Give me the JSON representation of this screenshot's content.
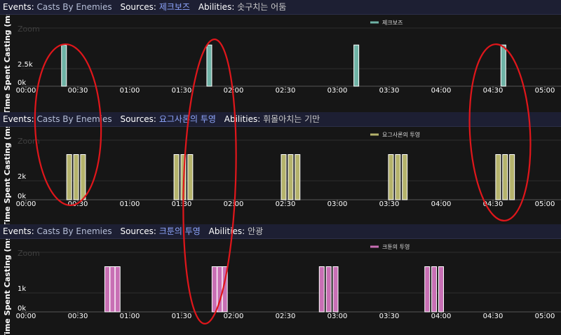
{
  "panels": [
    {
      "events_label": "Events:",
      "events_value": "Casts By Enemies",
      "sources_label": "Sources:",
      "sources_value": "제크보즈",
      "abilities_label": "Abilities:",
      "abilities_value": "솟구치는 어둠"
    },
    {
      "events_label": "Events:",
      "events_value": "Casts By Enemies",
      "sources_label": "Sources:",
      "sources_value": "요그사론의 투영",
      "abilities_label": "Abilities:",
      "abilities_value": "휘몰아치는 기만"
    },
    {
      "events_label": "Events:",
      "events_value": "Casts By Enemies",
      "sources_label": "Sources:",
      "sources_value": "크툰의 투영",
      "abilities_label": "Abilities:",
      "abilities_value": "안광"
    }
  ],
  "chart_data": [
    {
      "type": "bar",
      "title": "",
      "ylabel": "Time Spent Casting (ms)",
      "zoom_label": "Zoom",
      "x_ticks": [
        "00:00",
        "00:30",
        "01:00",
        "01:30",
        "02:00",
        "02:30",
        "03:00",
        "03:30",
        "04:00",
        "04:30",
        "05:00"
      ],
      "y_ticks": [
        "0k",
        "2.5k"
      ],
      "ylim": [
        0,
        5000
      ],
      "xlim_seconds": [
        0,
        300
      ],
      "legend_position": "top-center",
      "series": [
        {
          "name": "제크보즈",
          "color": "#6fb3a6",
          "bars": [
            {
              "t_seconds": 22,
              "value": 3500
            },
            {
              "t_seconds": 106,
              "value": 3500
            },
            {
              "t_seconds": 191,
              "value": 3500
            },
            {
              "t_seconds": 276,
              "value": 3500
            }
          ]
        }
      ]
    },
    {
      "type": "bar",
      "title": "",
      "ylabel": "Time Spent Casting (ms)",
      "zoom_label": "Zoom",
      "x_ticks": [
        "00:00",
        "00:30",
        "01:00",
        "01:30",
        "02:00",
        "02:30",
        "03:00",
        "03:30",
        "04:00",
        "04:30",
        "05:00"
      ],
      "y_ticks": [
        "0k",
        "2k"
      ],
      "ylim": [
        0,
        4000
      ],
      "xlim_seconds": [
        0,
        300
      ],
      "legend_position": "top-center",
      "series": [
        {
          "name": "요그사론의 투영",
          "color": "#b5b36c",
          "bars": [
            {
              "t_seconds": 25,
              "value": 3000
            },
            {
              "t_seconds": 29,
              "value": 3000
            },
            {
              "t_seconds": 33,
              "value": 3000
            },
            {
              "t_seconds": 87,
              "value": 3000
            },
            {
              "t_seconds": 91,
              "value": 3000
            },
            {
              "t_seconds": 95,
              "value": 3000
            },
            {
              "t_seconds": 149,
              "value": 3000
            },
            {
              "t_seconds": 153,
              "value": 3000
            },
            {
              "t_seconds": 157,
              "value": 3000
            },
            {
              "t_seconds": 211,
              "value": 3000
            },
            {
              "t_seconds": 215,
              "value": 3000
            },
            {
              "t_seconds": 219,
              "value": 3000
            },
            {
              "t_seconds": 273,
              "value": 3000
            },
            {
              "t_seconds": 277,
              "value": 3000
            },
            {
              "t_seconds": 281,
              "value": 3000
            }
          ]
        }
      ]
    },
    {
      "type": "bar",
      "title": "",
      "ylabel": "Time Spent Casting (ms)",
      "zoom_label": "Zoom",
      "x_ticks": [
        "00:00",
        "00:30",
        "01:00",
        "01:30",
        "02:00",
        "02:30",
        "03:00",
        "03:30",
        "04:00",
        "04:30",
        "05:00"
      ],
      "y_ticks": [
        "0k",
        "1k"
      ],
      "ylim": [
        0,
        2000
      ],
      "xlim_seconds": [
        0,
        300
      ],
      "legend_position": "top-center",
      "series": [
        {
          "name": "크툰의 투영",
          "color": "#c86fb4",
          "bars": [
            {
              "t_seconds": 47,
              "value": 1500
            },
            {
              "t_seconds": 50,
              "value": 1500
            },
            {
              "t_seconds": 53,
              "value": 1500
            },
            {
              "t_seconds": 109,
              "value": 1500
            },
            {
              "t_seconds": 112,
              "value": 1500
            },
            {
              "t_seconds": 115,
              "value": 1500
            },
            {
              "t_seconds": 171,
              "value": 1500
            },
            {
              "t_seconds": 175,
              "value": 1500
            },
            {
              "t_seconds": 179,
              "value": 1500
            },
            {
              "t_seconds": 232,
              "value": 1500
            },
            {
              "t_seconds": 236,
              "value": 1500
            },
            {
              "t_seconds": 240,
              "value": 1500
            }
          ]
        }
      ]
    }
  ],
  "annotations": {
    "color": "#e0161b",
    "shape": "hand-drawn ellipses circling bars"
  }
}
